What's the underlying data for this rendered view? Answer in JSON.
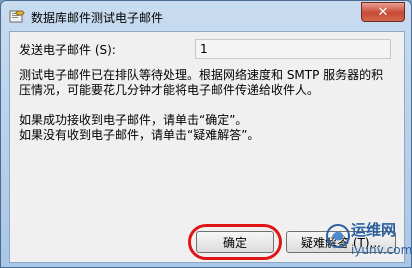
{
  "window": {
    "title": "数据库邮件测试电子邮件",
    "close_glyph": "✕"
  },
  "form": {
    "to_label": "发送电子邮件 (S):",
    "to_value": "1"
  },
  "description": {
    "line1": "测试电子邮件已在排队等待处理。根据网络速度和 SMTP 服务器的积",
    "line2": "压情况，可能要花几分钟才能将电子邮件传递给收件人。",
    "line3": "如果成功接收到电子邮件，请单击“确定”。",
    "line4": "如果没有收到电子邮件，请单击“疑难解答”。"
  },
  "buttons": {
    "ok_label": "确定",
    "troubleshoot_label": "疑难解答 (T)..."
  },
  "watermark": {
    "brand": "运维网",
    "url": "iyunv.com"
  },
  "colors": {
    "annotation": "#e01515",
    "close_button": "#c74a36",
    "watermark": "#2b5f9e"
  }
}
